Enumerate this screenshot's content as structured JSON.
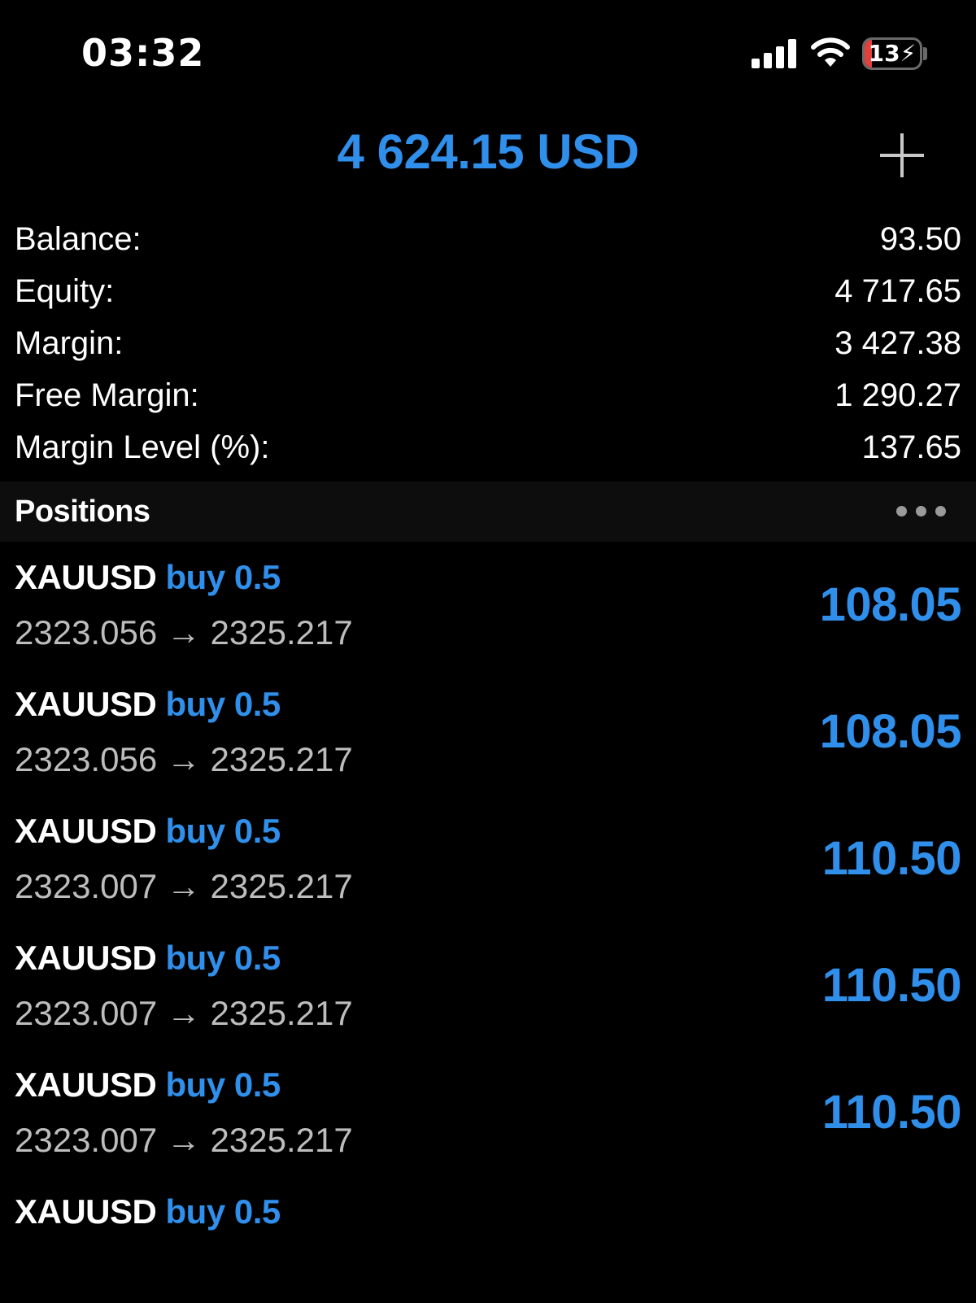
{
  "status_bar": {
    "time": "03:32",
    "battery_level": "13",
    "battery_percent": 13,
    "icons": [
      "signal-icon",
      "wifi-icon",
      "battery-charging-icon"
    ]
  },
  "header": {
    "total": "4 624.15 USD",
    "add_icon": "plus-icon"
  },
  "summary": [
    {
      "label": "Balance:",
      "value": "93.50"
    },
    {
      "label": "Equity:",
      "value": "4 717.65"
    },
    {
      "label": "Margin:",
      "value": "3 427.38"
    },
    {
      "label": "Free Margin:",
      "value": "1 290.27"
    },
    {
      "label": "Margin Level (%):",
      "value": "137.65"
    }
  ],
  "positions": {
    "title": "Positions",
    "more_icon": "more-dots-icon",
    "items": [
      {
        "symbol": "XAUUSD",
        "side": "buy 0.5",
        "prices": "2323.056 → 2325.217",
        "profit": "108.05"
      },
      {
        "symbol": "XAUUSD",
        "side": "buy 0.5",
        "prices": "2323.056 → 2325.217",
        "profit": "108.05"
      },
      {
        "symbol": "XAUUSD",
        "side": "buy 0.5",
        "prices": "2323.007 → 2325.217",
        "profit": "110.50"
      },
      {
        "symbol": "XAUUSD",
        "side": "buy 0.5",
        "prices": "2323.007 → 2325.217",
        "profit": "110.50"
      },
      {
        "symbol": "XAUUSD",
        "side": "buy 0.5",
        "prices": "2323.007 → 2325.217",
        "profit": "110.50"
      },
      {
        "symbol": "XAUUSD",
        "side": "buy 0.5",
        "prices": "",
        "profit": ""
      }
    ]
  },
  "colors": {
    "accent": "#2f8fea",
    "background": "#000000",
    "battery_low": "#e2403a"
  }
}
